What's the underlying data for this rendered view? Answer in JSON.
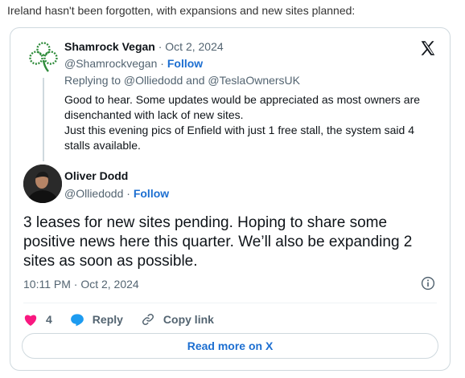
{
  "intro_text": "Ireland hasn't been forgotten, with expansions and new sites planned:",
  "brand": {
    "logo_icon": "x-logo-icon",
    "link_color": "#1d6fd1",
    "like_color": "#f91880"
  },
  "quoted_tweet": {
    "author_name": "Shamrock Vegan",
    "separator": " · ",
    "date": "Oct 2, 2024",
    "handle": "@Shamrockvegan",
    "follow_label": "Follow",
    "reply_context": "Replying to @Olliedodd and @TeslaOwnersUK",
    "body_lines": [
      "Good to hear. Some updates would be appreciated as most owners are disenchanted with lack of new sites.",
      "Just this evening pics of Enfield with just 1 free stall, the system said 4 stalls available."
    ]
  },
  "main_tweet": {
    "author_name": "Oliver Dodd",
    "handle": "@Olliedodd",
    "separator": " · ",
    "follow_label": "Follow",
    "body": "3 leases for new sites pending. Hoping to share some positive news here this quarter. We’ll also be expanding 2 sites as soon as possible.",
    "timestamp": "10:11 PM · Oct 2, 2024"
  },
  "actions": {
    "like_count": "4",
    "reply_label": "Reply",
    "copy_link_label": "Copy link"
  },
  "read_more_label": "Read more on X"
}
